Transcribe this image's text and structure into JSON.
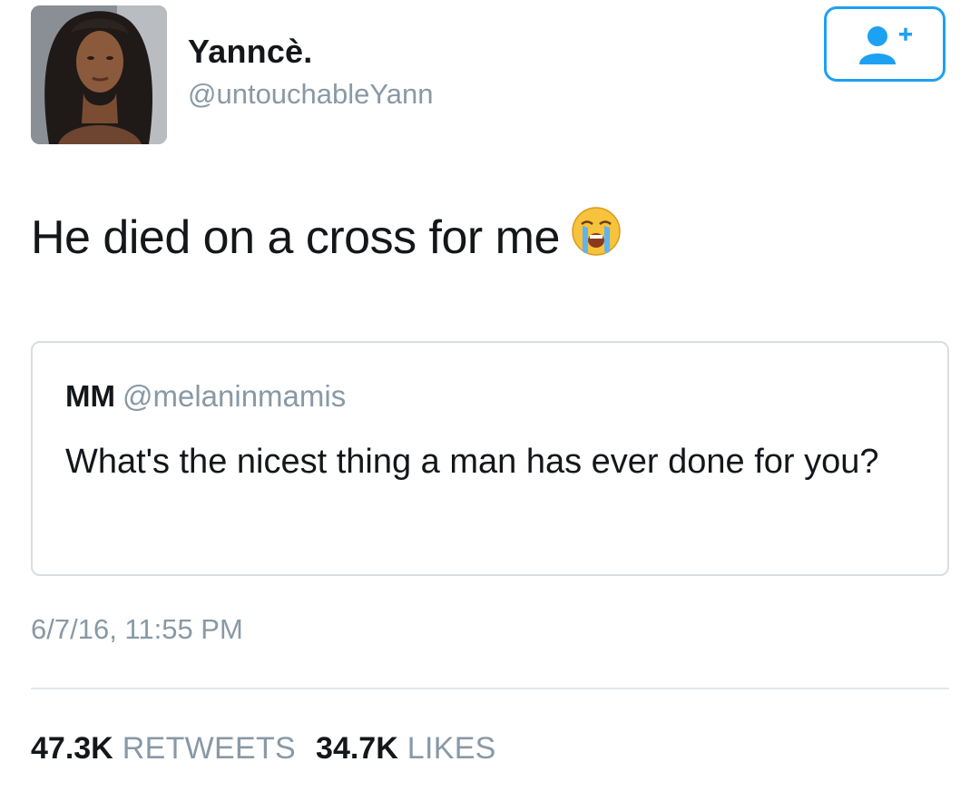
{
  "author": {
    "display_name": "Yanncè.",
    "handle": "@untouchableYann",
    "avatar_icon": "profile-photo"
  },
  "follow_button": {
    "icon": "add-user-icon",
    "color": "#1da1f2"
  },
  "tweet": {
    "text": "He died on a cross for me",
    "emoji": "loudly-crying-face"
  },
  "quote": {
    "name": "MM",
    "handle": "@melaninmamis",
    "text": "What's the nicest thing a man has ever done for you?"
  },
  "timestamp": "6/7/16, 11:55 PM",
  "stats": {
    "retweets_count": "47.3K",
    "retweets_label": "RETWEETS",
    "likes_count": "34.7K",
    "likes_label": "LIKES"
  },
  "colors": {
    "primary_text": "#14171a",
    "secondary_text": "#8899a6",
    "accent": "#1da1f2",
    "border": "#d8dde2"
  }
}
